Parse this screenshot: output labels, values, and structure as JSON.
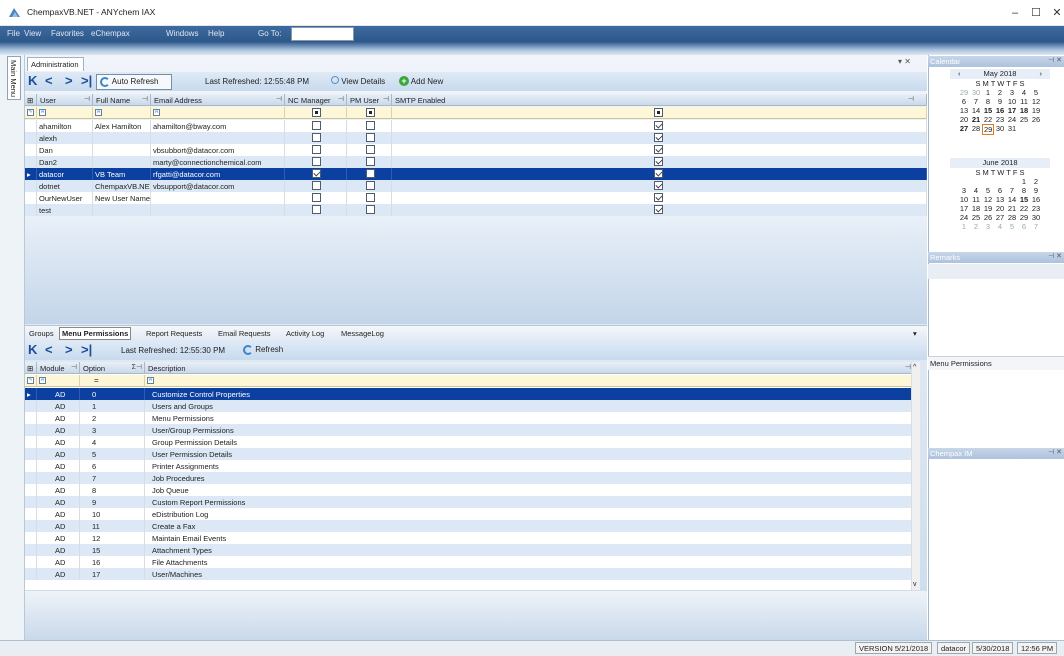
{
  "window": {
    "title": "ChempaxVB.NET - ANYchem IAX",
    "min": "–",
    "max": "☐",
    "close": "✕"
  },
  "menubar": {
    "items": [
      "File",
      "View",
      "Favorites",
      "eChempax",
      "Windows",
      "Help"
    ],
    "goto_label": "Go To:",
    "goto_value": ""
  },
  "sidebar": {
    "main_menu_label": "Main Menu"
  },
  "doc": {
    "tab": "Administration",
    "close_controls": "▾ ✕"
  },
  "toolbar1": {
    "first": "K",
    "prev": "<",
    "next": ">",
    "last": ">|",
    "auto_refresh": "Auto Refresh",
    "last_refreshed": "Last Refreshed: 12:55:48 PM",
    "view_details": "View Details",
    "add_new": "Add New"
  },
  "users_grid": {
    "columns": [
      "User",
      "Full Name",
      "Email Address",
      "NC Manager",
      "PM User",
      "SMTP Enabled"
    ],
    "rows": [
      {
        "user": "ahamilton",
        "full": "Alex Hamilton",
        "email": "ahamilton@bway.com",
        "nc": false,
        "pm": false,
        "smtp": true
      },
      {
        "user": "alexh",
        "full": "",
        "email": "",
        "nc": false,
        "pm": false,
        "smtp": true
      },
      {
        "user": "Dan",
        "full": "",
        "email": "vbsubbort@datacor.com",
        "nc": false,
        "pm": false,
        "smtp": true
      },
      {
        "user": "Dan2",
        "full": "",
        "email": "marty@connectionchemical.com",
        "nc": false,
        "pm": false,
        "smtp": true
      },
      {
        "user": "datacor",
        "full": "VB Team",
        "email": "rfgatti@datacor.com",
        "nc": true,
        "pm": false,
        "smtp": true,
        "selected": true
      },
      {
        "user": "dotnet",
        "full": "ChempaxVB.NET",
        "email": "vbsupport@datacor.com",
        "nc": false,
        "pm": false,
        "smtp": true
      },
      {
        "user": "OurNewUser",
        "full": "New User Name",
        "email": "",
        "nc": false,
        "pm": false,
        "smtp": true
      },
      {
        "user": "test",
        "full": "",
        "email": "",
        "nc": false,
        "pm": false,
        "smtp": true
      }
    ]
  },
  "tabs": {
    "items": [
      "Groups",
      "Menu Permissions",
      "Report Requests",
      "Email Requests",
      "Activity Log",
      "MessageLog"
    ],
    "active": "Menu Permissions"
  },
  "toolbar2": {
    "last_refreshed": "Last Refreshed: 12:55:30 PM",
    "refresh": "Refresh"
  },
  "perm_grid": {
    "columns": [
      "Module",
      "Option",
      "Description"
    ],
    "rows": [
      {
        "module": "AD",
        "option": "0",
        "desc": "Customize Control Properties",
        "selected": true
      },
      {
        "module": "AD",
        "option": "1",
        "desc": "Users and Groups"
      },
      {
        "module": "AD",
        "option": "2",
        "desc": "Menu Permissions"
      },
      {
        "module": "AD",
        "option": "3",
        "desc": "User/Group Permissions"
      },
      {
        "module": "AD",
        "option": "4",
        "desc": "Group Permission Details"
      },
      {
        "module": "AD",
        "option": "5",
        "desc": "User Permission Details"
      },
      {
        "module": "AD",
        "option": "6",
        "desc": "Printer Assignments"
      },
      {
        "module": "AD",
        "option": "7",
        "desc": "Job Procedures"
      },
      {
        "module": "AD",
        "option": "8",
        "desc": "Job Queue"
      },
      {
        "module": "AD",
        "option": "9",
        "desc": "Custom Report Permissions"
      },
      {
        "module": "AD",
        "option": "10",
        "desc": "eDistribution Log"
      },
      {
        "module": "AD",
        "option": "11",
        "desc": "Create a Fax"
      },
      {
        "module": "AD",
        "option": "12",
        "desc": "Maintain Email Events"
      },
      {
        "module": "AD",
        "option": "15",
        "desc": "Attachment Types"
      },
      {
        "module": "AD",
        "option": "16",
        "desc": "File Attachments"
      },
      {
        "module": "AD",
        "option": "17",
        "desc": "User/Machines"
      }
    ]
  },
  "right": {
    "calendar_title": "Calendar",
    "may": {
      "title": "May 2018",
      "dow": "S M T W T F S",
      "weeks": [
        [
          "29",
          "30",
          "1",
          "2",
          "3",
          "4",
          "5"
        ],
        [
          "6",
          "7",
          "8",
          "9",
          "10",
          "11",
          "12"
        ],
        [
          "13",
          "14",
          "15",
          "16",
          "17",
          "18",
          "19"
        ],
        [
          "20",
          "21",
          "22",
          "23",
          "24",
          "25",
          "26"
        ],
        [
          "27",
          "28",
          "29",
          "30",
          "31",
          "",
          ""
        ]
      ]
    },
    "june": {
      "title": "June 2018",
      "dow": "S M T W T F S",
      "weeks": [
        [
          "",
          "",
          "",
          "",
          "",
          "1",
          "2"
        ],
        [
          "3",
          "4",
          "5",
          "6",
          "7",
          "8",
          "9"
        ],
        [
          "10",
          "11",
          "12",
          "13",
          "14",
          "15",
          "16"
        ],
        [
          "17",
          "18",
          "19",
          "20",
          "21",
          "22",
          "23"
        ],
        [
          "24",
          "25",
          "26",
          "27",
          "28",
          "29",
          "30"
        ],
        [
          "1",
          "2",
          "3",
          "4",
          "5",
          "6",
          "7"
        ]
      ]
    },
    "remarks_title": "Remarks",
    "menu_perm_title": "Menu Permissions",
    "chempax_im_title": "Chempax IM"
  },
  "status": {
    "version": "VERSION 5/21/2018",
    "user": "datacor",
    "date": "5/30/2018",
    "time": "12:56 PM"
  }
}
